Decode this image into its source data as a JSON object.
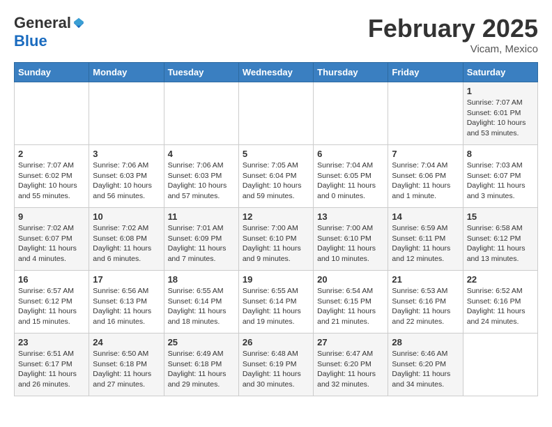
{
  "logo": {
    "general": "General",
    "blue": "Blue"
  },
  "title": "February 2025",
  "location": "Vicam, Mexico",
  "days_of_week": [
    "Sunday",
    "Monday",
    "Tuesday",
    "Wednesday",
    "Thursday",
    "Friday",
    "Saturday"
  ],
  "weeks": [
    [
      {
        "day": "",
        "info": ""
      },
      {
        "day": "",
        "info": ""
      },
      {
        "day": "",
        "info": ""
      },
      {
        "day": "",
        "info": ""
      },
      {
        "day": "",
        "info": ""
      },
      {
        "day": "",
        "info": ""
      },
      {
        "day": "1",
        "info": "Sunrise: 7:07 AM\nSunset: 6:01 PM\nDaylight: 10 hours and 53 minutes."
      }
    ],
    [
      {
        "day": "2",
        "info": "Sunrise: 7:07 AM\nSunset: 6:02 PM\nDaylight: 10 hours and 55 minutes."
      },
      {
        "day": "3",
        "info": "Sunrise: 7:06 AM\nSunset: 6:03 PM\nDaylight: 10 hours and 56 minutes."
      },
      {
        "day": "4",
        "info": "Sunrise: 7:06 AM\nSunset: 6:03 PM\nDaylight: 10 hours and 57 minutes."
      },
      {
        "day": "5",
        "info": "Sunrise: 7:05 AM\nSunset: 6:04 PM\nDaylight: 10 hours and 59 minutes."
      },
      {
        "day": "6",
        "info": "Sunrise: 7:04 AM\nSunset: 6:05 PM\nDaylight: 11 hours and 0 minutes."
      },
      {
        "day": "7",
        "info": "Sunrise: 7:04 AM\nSunset: 6:06 PM\nDaylight: 11 hours and 1 minute."
      },
      {
        "day": "8",
        "info": "Sunrise: 7:03 AM\nSunset: 6:07 PM\nDaylight: 11 hours and 3 minutes."
      }
    ],
    [
      {
        "day": "9",
        "info": "Sunrise: 7:02 AM\nSunset: 6:07 PM\nDaylight: 11 hours and 4 minutes."
      },
      {
        "day": "10",
        "info": "Sunrise: 7:02 AM\nSunset: 6:08 PM\nDaylight: 11 hours and 6 minutes."
      },
      {
        "day": "11",
        "info": "Sunrise: 7:01 AM\nSunset: 6:09 PM\nDaylight: 11 hours and 7 minutes."
      },
      {
        "day": "12",
        "info": "Sunrise: 7:00 AM\nSunset: 6:10 PM\nDaylight: 11 hours and 9 minutes."
      },
      {
        "day": "13",
        "info": "Sunrise: 7:00 AM\nSunset: 6:10 PM\nDaylight: 11 hours and 10 minutes."
      },
      {
        "day": "14",
        "info": "Sunrise: 6:59 AM\nSunset: 6:11 PM\nDaylight: 11 hours and 12 minutes."
      },
      {
        "day": "15",
        "info": "Sunrise: 6:58 AM\nSunset: 6:12 PM\nDaylight: 11 hours and 13 minutes."
      }
    ],
    [
      {
        "day": "16",
        "info": "Sunrise: 6:57 AM\nSunset: 6:12 PM\nDaylight: 11 hours and 15 minutes."
      },
      {
        "day": "17",
        "info": "Sunrise: 6:56 AM\nSunset: 6:13 PM\nDaylight: 11 hours and 16 minutes."
      },
      {
        "day": "18",
        "info": "Sunrise: 6:55 AM\nSunset: 6:14 PM\nDaylight: 11 hours and 18 minutes."
      },
      {
        "day": "19",
        "info": "Sunrise: 6:55 AM\nSunset: 6:14 PM\nDaylight: 11 hours and 19 minutes."
      },
      {
        "day": "20",
        "info": "Sunrise: 6:54 AM\nSunset: 6:15 PM\nDaylight: 11 hours and 21 minutes."
      },
      {
        "day": "21",
        "info": "Sunrise: 6:53 AM\nSunset: 6:16 PM\nDaylight: 11 hours and 22 minutes."
      },
      {
        "day": "22",
        "info": "Sunrise: 6:52 AM\nSunset: 6:16 PM\nDaylight: 11 hours and 24 minutes."
      }
    ],
    [
      {
        "day": "23",
        "info": "Sunrise: 6:51 AM\nSunset: 6:17 PM\nDaylight: 11 hours and 26 minutes."
      },
      {
        "day": "24",
        "info": "Sunrise: 6:50 AM\nSunset: 6:18 PM\nDaylight: 11 hours and 27 minutes."
      },
      {
        "day": "25",
        "info": "Sunrise: 6:49 AM\nSunset: 6:18 PM\nDaylight: 11 hours and 29 minutes."
      },
      {
        "day": "26",
        "info": "Sunrise: 6:48 AM\nSunset: 6:19 PM\nDaylight: 11 hours and 30 minutes."
      },
      {
        "day": "27",
        "info": "Sunrise: 6:47 AM\nSunset: 6:20 PM\nDaylight: 11 hours and 32 minutes."
      },
      {
        "day": "28",
        "info": "Sunrise: 6:46 AM\nSunset: 6:20 PM\nDaylight: 11 hours and 34 minutes."
      },
      {
        "day": "",
        "info": ""
      }
    ]
  ]
}
